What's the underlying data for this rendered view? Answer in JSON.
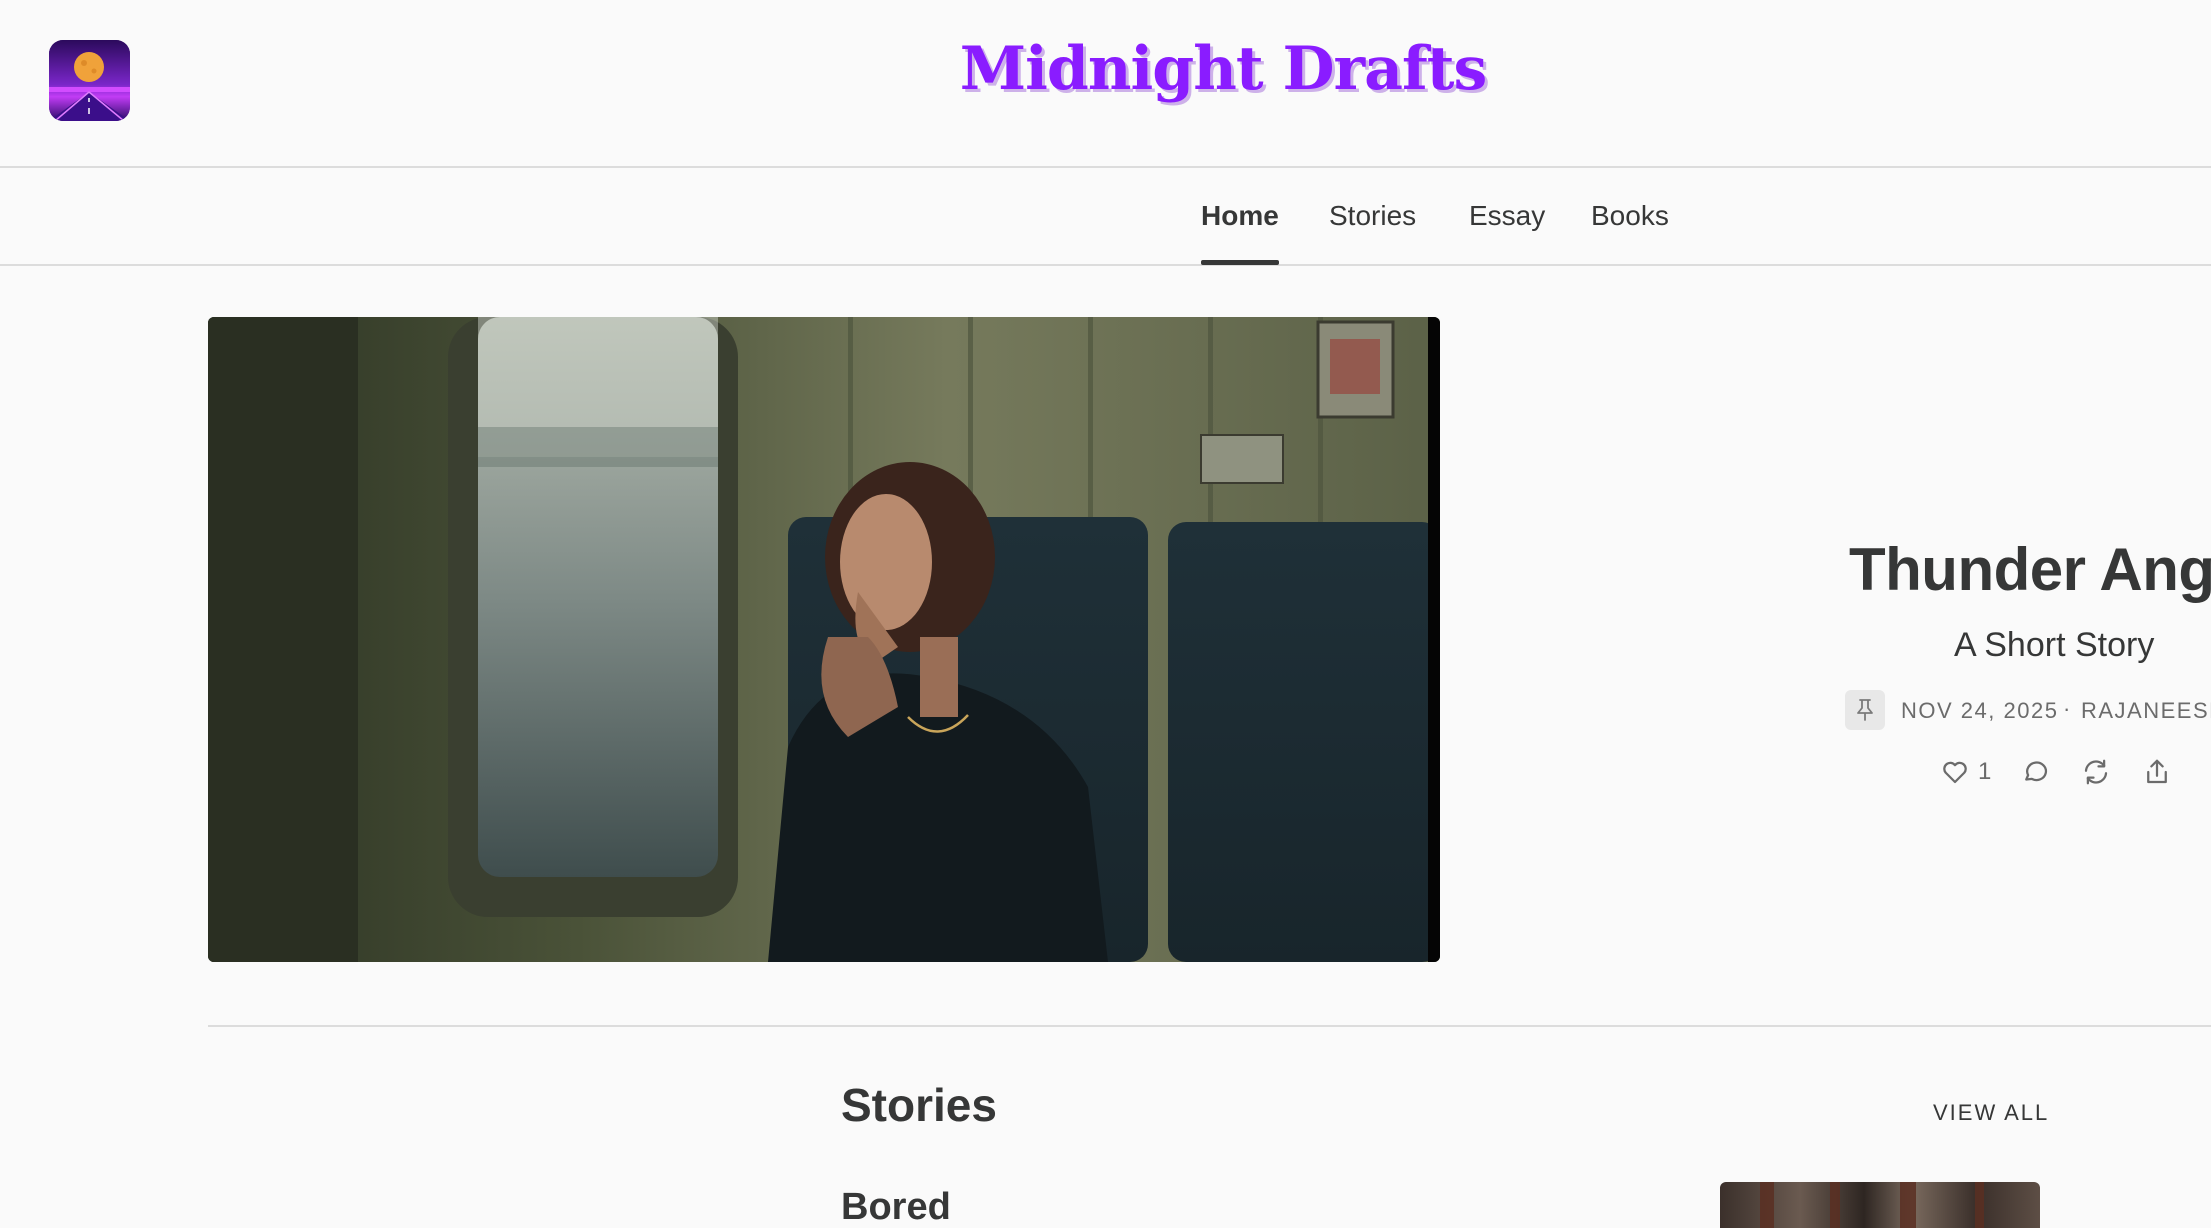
{
  "header": {
    "site_title": "Midnight Drafts",
    "logo_icon": "moon-road-logo-icon"
  },
  "nav": {
    "tabs": [
      {
        "label": "Home",
        "active": true
      },
      {
        "label": "Stories",
        "active": false
      },
      {
        "label": "Essay",
        "active": false
      },
      {
        "label": "Books",
        "active": false
      }
    ]
  },
  "hero": {
    "image_icon": "woman-on-train-photo",
    "title": "Thunder Ang",
    "subtitle": "A Short Story",
    "pinned_icon": "pin-icon",
    "date": "NOV 24, 2025",
    "separator": "·",
    "author": "RAJANEESH",
    "like_count": "1",
    "actions": [
      "heart-icon",
      "comment-icon",
      "restack-icon",
      "share-icon"
    ]
  },
  "stories_section": {
    "title": "Stories",
    "view_all_label": "VIEW ALL",
    "posts": [
      {
        "title": "Bored",
        "thumb_icon": "forest-thumbnail"
      }
    ]
  },
  "colors": {
    "brand": "#8a1cff",
    "text": "#363737",
    "muted": "#6b6b6b",
    "background": "#fafafa",
    "border": "#dcdcdc"
  }
}
